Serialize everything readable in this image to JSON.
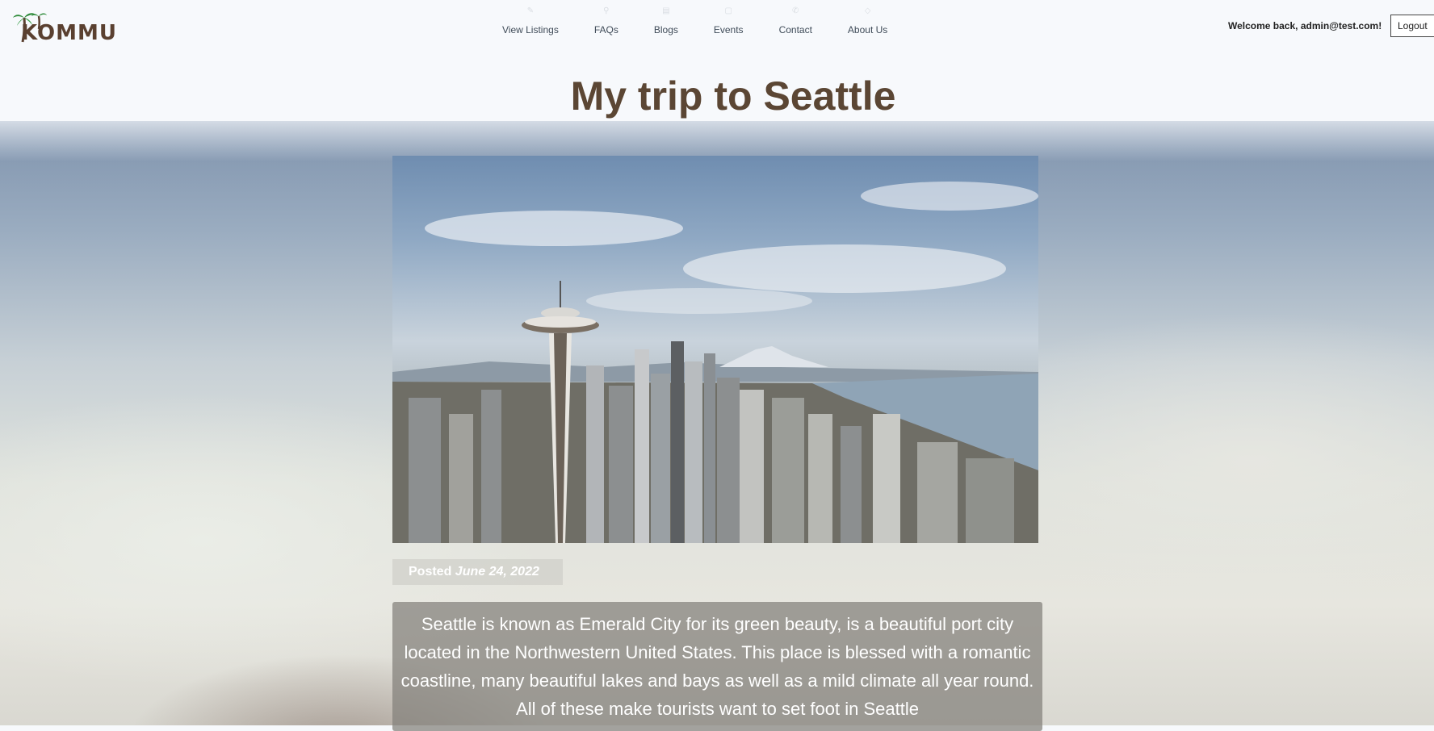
{
  "brand": {
    "logo_text": "KOMMU"
  },
  "nav": [
    {
      "label": "View Listings",
      "icon": "listings-icon"
    },
    {
      "label": "FAQs",
      "icon": "question-icon"
    },
    {
      "label": "Blogs",
      "icon": "blog-icon"
    },
    {
      "label": "Events",
      "icon": "calendar-icon"
    },
    {
      "label": "Contact",
      "icon": "phone-icon"
    },
    {
      "label": "About Us",
      "icon": "info-icon"
    }
  ],
  "user": {
    "welcome": "Welcome back, admin@test.com!",
    "logout_label": "Logout"
  },
  "post": {
    "title": "My trip to Seattle",
    "hero_image": "seattle-skyline-space-needle",
    "posted_label": "Posted",
    "posted_date": "June 24, 2022",
    "body": "Seattle is known as Emerald City for its green beauty, is a beautiful port city located in the Northwestern United States. This place is blessed with a romantic coastline, many beautiful lakes and bays as well as a mild climate all year round. All of these make tourists want to set foot in Seattle"
  },
  "colors": {
    "title": "#5b4634",
    "logo": "#5a4030",
    "palm": "#2e8b3a"
  }
}
